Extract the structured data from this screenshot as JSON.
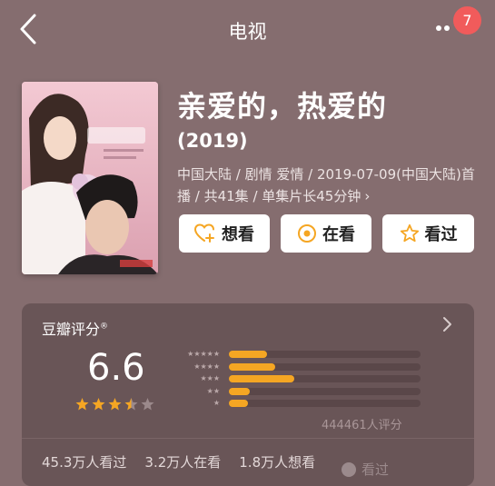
{
  "header": {
    "title": "电视",
    "notification_count": "7"
  },
  "show": {
    "title": "亲爱的，热爱的",
    "year": "(2019)",
    "meta": "中国大陆 / 剧情 爱情 / 2019-07-09(中国大陆)首播 / 共41集 / 单集片长45分钟",
    "meta_chevron": "›"
  },
  "actions": {
    "want": "想看",
    "watching": "在看",
    "watched": "看过"
  },
  "rating": {
    "title": "豆瓣评分",
    "title_mark": "®",
    "score": "6.6",
    "score_value": 6.6,
    "stars_filled": 3.5,
    "stars_max": 5,
    "distribution": [
      {
        "stars": 5,
        "fraction": 0.2
      },
      {
        "stars": 4,
        "fraction": 0.24
      },
      {
        "stars": 3,
        "fraction": 0.34
      },
      {
        "stars": 2,
        "fraction": 0.11
      },
      {
        "stars": 1,
        "fraction": 0.1
      }
    ],
    "total_label": "444461人评分",
    "stats": [
      "45.3万人看过",
      "3.2万人在看",
      "1.8万人想看"
    ],
    "watermark": "看过"
  },
  "colors": {
    "background": "#856d6f",
    "card": "#695557",
    "accent": "#f5a623",
    "badge": "#f15b5b"
  },
  "icons": {
    "back": "chevron-left-icon",
    "more": "more-dots-icon",
    "want": "heart-plus-icon",
    "watching": "target-circle-icon",
    "watched": "star-outline-icon"
  }
}
